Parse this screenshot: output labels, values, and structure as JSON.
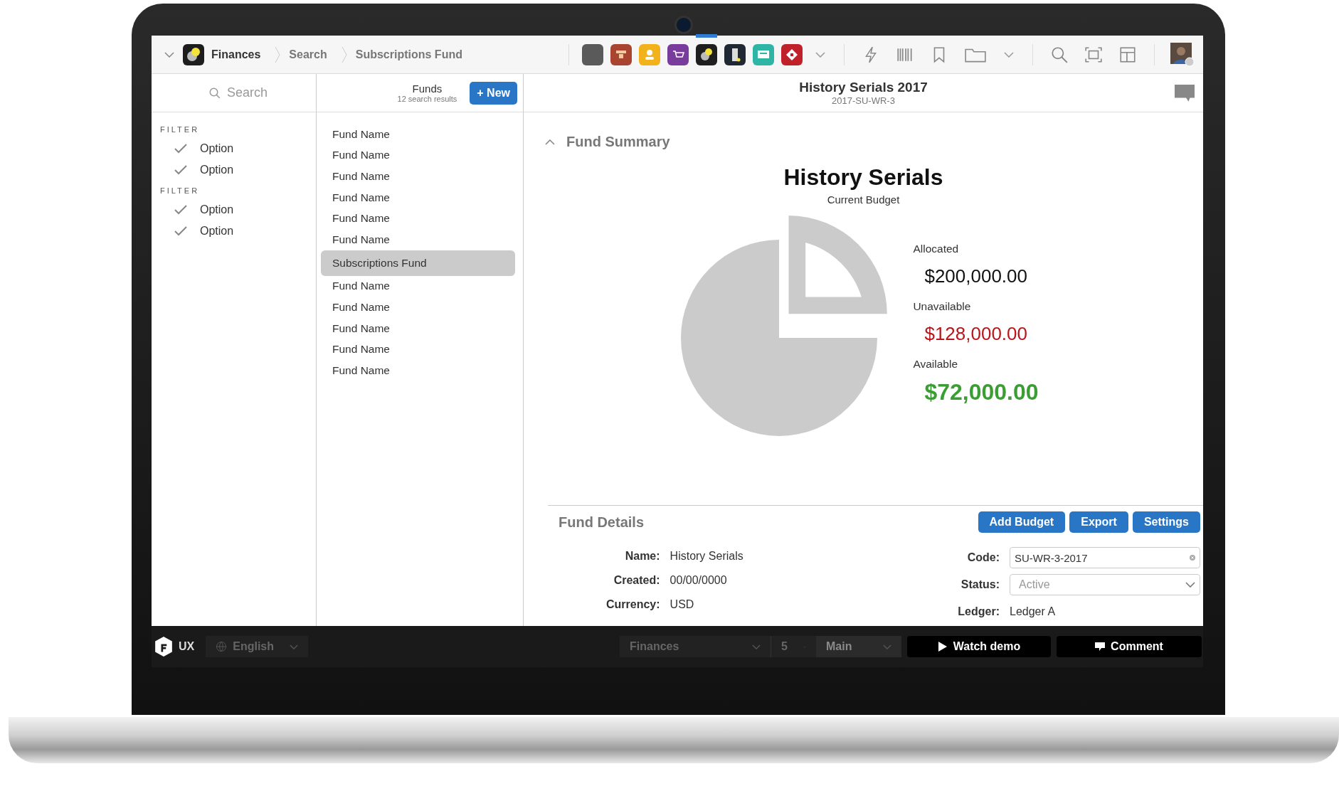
{
  "top_bar": {
    "app_name": "Finances",
    "breadcrumbs": [
      "Search",
      "Subscriptions Fund"
    ]
  },
  "sidebar": {
    "search": {
      "placeholder": "Search"
    },
    "filters": [
      {
        "title": "FILTER",
        "options": [
          {
            "label": "Option",
            "checked": true
          },
          {
            "label": "Option",
            "checked": true
          }
        ]
      },
      {
        "title": "FILTER",
        "options": [
          {
            "label": "Option",
            "checked": true
          },
          {
            "label": "Option",
            "checked": true
          }
        ]
      }
    ]
  },
  "funds": {
    "title": "Funds",
    "count": "12 search results",
    "new_button": "+ New",
    "items": [
      {
        "label": "Fund Name",
        "selected": false
      },
      {
        "label": "Fund Name",
        "selected": false
      },
      {
        "label": "Fund Name",
        "selected": false
      },
      {
        "label": "Fund Name",
        "selected": false
      },
      {
        "label": "Fund Name",
        "selected": false
      },
      {
        "label": "Fund Name",
        "selected": false
      },
      {
        "label": "Subscriptions Fund",
        "selected": true
      },
      {
        "label": "Fund Name",
        "selected": false
      },
      {
        "label": "Fund Name",
        "selected": false
      },
      {
        "label": "Fund Name",
        "selected": false
      },
      {
        "label": "Fund Name",
        "selected": false
      },
      {
        "label": "Fund Name",
        "selected": false
      }
    ]
  },
  "record": {
    "title": "History Serials 2017",
    "subtitle": "2017-SU-WR-3"
  },
  "summary": {
    "heading": "Fund Summary",
    "expanded": true,
    "title": "History Serials",
    "subtitle": "Current Budget",
    "amounts": [
      {
        "label": "Allocated",
        "value": "$200,000.00",
        "kind": "neutral"
      },
      {
        "label": "Unavailable",
        "value": "$128,000.00",
        "kind": "negative"
      },
      {
        "label": "Available",
        "value": "$72,000.00",
        "kind": "positive"
      }
    ]
  },
  "details": {
    "heading": "Fund Details",
    "buttons": [
      "Add Budget",
      "Export",
      "Settings"
    ],
    "left_fields": [
      {
        "label": "Name:",
        "value": "History Serials"
      },
      {
        "label": "Created:",
        "value": "00/00/0000"
      },
      {
        "label": "Currency:",
        "value": "USD"
      }
    ],
    "right_fields": [
      {
        "label": "Code:",
        "value": "SU-WR-3-2017",
        "kind": "input"
      },
      {
        "label": "Status:",
        "value": "Active",
        "kind": "select"
      },
      {
        "label": "Ledger:",
        "value": "Ledger A",
        "kind": "text"
      }
    ]
  },
  "bottom_bar": {
    "brand": "UX",
    "language": "English",
    "app": "Finances",
    "number": "5",
    "view": "Main",
    "watch_button": "Watch demo",
    "comment_button": "Comment"
  }
}
